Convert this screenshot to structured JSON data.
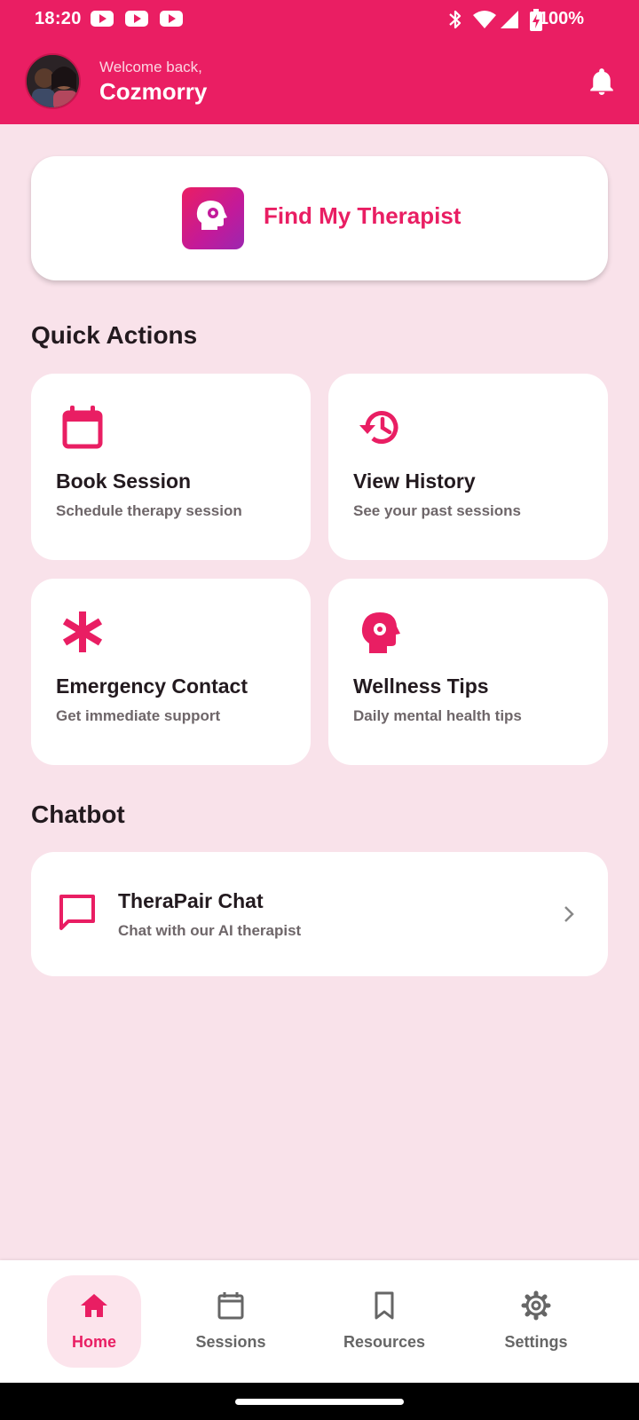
{
  "status_bar": {
    "time": "18:20",
    "battery_percent": "100%",
    "icons": [
      "youtube-icon",
      "youtube-icon",
      "youtube-icon",
      "bluetooth-icon",
      "wifi-icon",
      "signal-icon",
      "battery-charging-icon"
    ]
  },
  "header": {
    "welcome": "Welcome back,",
    "username": "Cozmorry",
    "notification_icon": "bell-icon"
  },
  "find_therapist": {
    "label": "Find My Therapist",
    "icon": "head-gear-icon"
  },
  "quick_actions": {
    "title": "Quick Actions",
    "items": [
      {
        "title": "Book Session",
        "subtitle": "Schedule therapy session",
        "icon": "calendar-icon"
      },
      {
        "title": "View History",
        "subtitle": "See your past sessions",
        "icon": "history-icon"
      },
      {
        "title": "Emergency Contact",
        "subtitle": "Get immediate support",
        "icon": "asterisk-icon"
      },
      {
        "title": "Wellness Tips",
        "subtitle": "Daily mental health tips",
        "icon": "head-gear-icon"
      }
    ]
  },
  "chatbot": {
    "title": "Chatbot",
    "item": {
      "title": "TheraPair Chat",
      "subtitle": "Chat with our AI therapist",
      "icon": "chat-bubble-icon"
    }
  },
  "bottom_nav": {
    "items": [
      {
        "label": "Home",
        "icon": "home-icon",
        "active": true
      },
      {
        "label": "Sessions",
        "icon": "calendar-icon",
        "active": false
      },
      {
        "label": "Resources",
        "icon": "bookmark-icon",
        "active": false
      },
      {
        "label": "Settings",
        "icon": "gear-icon",
        "active": false
      }
    ]
  },
  "colors": {
    "primary": "#e91e63",
    "background": "#f9e2ea",
    "card": "#ffffff",
    "text": "#231a1f",
    "muted_text": "#6e6669"
  }
}
